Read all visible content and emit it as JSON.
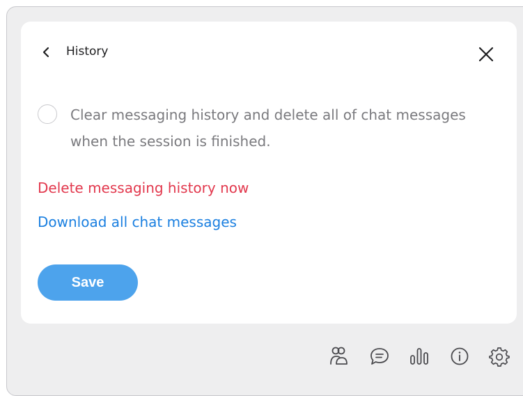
{
  "header": {
    "title": "History",
    "back_icon": "chevron-left-icon",
    "close_icon": "close-icon"
  },
  "option": {
    "label": "Clear messaging history and delete all of chat messages when the session is finished.",
    "checked": false
  },
  "actions": {
    "delete_label": "Delete messaging history now",
    "download_label": "Download all chat messages",
    "save_label": "Save"
  },
  "toolbar": {
    "icons": [
      "participants-icon",
      "chat-icon",
      "stats-icon",
      "info-icon",
      "settings-icon"
    ]
  },
  "colors": {
    "delete_link": "#e2384d",
    "download_link": "#1a7fe0",
    "save_button": "#4da3ec",
    "panel_background": "#eeeeef"
  }
}
